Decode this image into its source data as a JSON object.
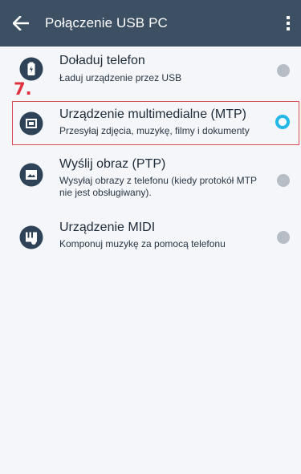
{
  "header": {
    "title": "Połączenie USB PC"
  },
  "annotation": {
    "step": "7."
  },
  "options": [
    {
      "label": "Doładuj telefon",
      "description": "Ładuj urządzenie przez USB",
      "icon": "battery-icon",
      "selected": false
    },
    {
      "label": "Urządzenie multimedialne (MTP)",
      "description": "Przesyłaj zdjęcia, muzykę, filmy i dokumenty",
      "icon": "media-device-icon",
      "selected": true
    },
    {
      "label": "Wyślij obraz (PTP)",
      "description": "Wysyłaj obrazy z telefonu (kiedy protokół MTP nie jest obsługiwany).",
      "icon": "image-icon",
      "selected": false
    },
    {
      "label": "Urządzenie MIDI",
      "description": "Komponuj muzykę za pomocą telefonu",
      "icon": "midi-icon",
      "selected": false
    }
  ],
  "colors": {
    "appbar": "#3d4f63",
    "icon": "#2f4358",
    "accent": "#23b8e8",
    "highlight": "#d94a55"
  }
}
